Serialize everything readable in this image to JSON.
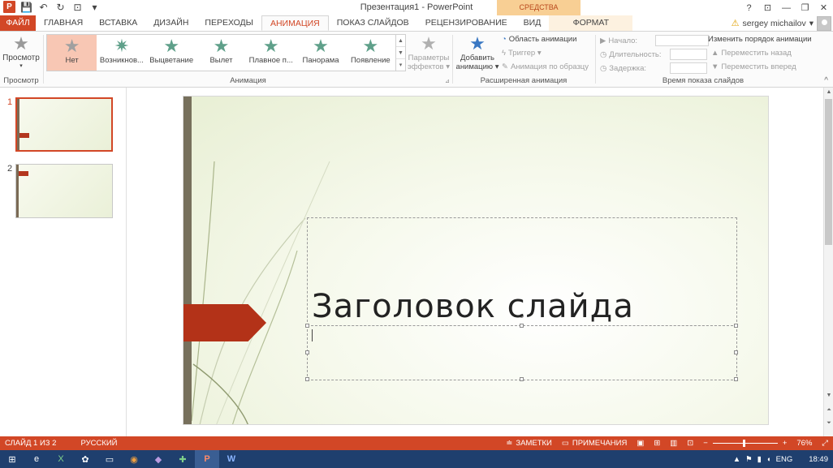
{
  "window": {
    "title": "Презентация1 - PowerPoint",
    "context_tab_header": "СРЕДСТВА РИСОВАНИЯ",
    "help": "?",
    "controls": [
      "⊡",
      "—",
      "❐",
      "✕"
    ]
  },
  "qat": {
    "app_icon": "P",
    "save": "💾",
    "undo": "↶",
    "redo": "↻",
    "present": "⊡",
    "more": "▾"
  },
  "tabs": [
    {
      "label": "ФАЙЛ"
    },
    {
      "label": "ГЛАВНАЯ"
    },
    {
      "label": "ВСТАВКА"
    },
    {
      "label": "ДИЗАЙН"
    },
    {
      "label": "ПЕРЕХОДЫ"
    },
    {
      "label": "АНИМАЦИЯ"
    },
    {
      "label": "ПОКАЗ СЛАЙДОВ"
    },
    {
      "label": "РЕЦЕНЗИРОВАНИЕ"
    },
    {
      "label": "ВИД"
    },
    {
      "label": "ФОРМАТ"
    }
  ],
  "user": {
    "name": "sergey michailov",
    "arrow": "▾",
    "warning": "⚠"
  },
  "ribbon": {
    "preview": {
      "label": "Просмотр",
      "group": "Просмотр"
    },
    "animation_group": "Анимация",
    "gallery": [
      "Нет",
      "Возникнов...",
      "Выцветание",
      "Вылет",
      "Плавное п...",
      "Панорама",
      "Появление"
    ],
    "effect_params": [
      "Параметры",
      "эффектов ▾"
    ],
    "add_animation": [
      "Добавить",
      "анимацию ▾"
    ],
    "anim_pane": "Область анимации",
    "trigger": "Триггер ▾",
    "anim_painter": "Анимация по образцу",
    "advanced_group": "Расширенная анимация",
    "start": "Начало:",
    "duration": "Длительность:",
    "delay": "Задержка:",
    "reorder_title": "Изменить порядок анимации",
    "move_back": "Переместить назад",
    "move_forward": "Переместить вперед",
    "timing_group": "Время показа слайдов",
    "collapse": "^"
  },
  "thumbnails": [
    {
      "num": "1"
    },
    {
      "num": "2"
    }
  ],
  "slide": {
    "title": "Заголовок слайда"
  },
  "statusbar": {
    "slide_info": "СЛАЙД 1 ИЗ 2",
    "language": "РУССКИЙ",
    "notes": "ЗАМЕТКИ",
    "comments": "ПРИМЕЧАНИЯ",
    "zoom_minus": "−",
    "zoom_plus": "+",
    "zoom": "76%"
  },
  "taskbar": {
    "icons": [
      "⊞",
      "e",
      "X",
      "✿",
      "▭",
      "◉",
      "◆",
      "✚",
      "P",
      "W"
    ],
    "lang": "ENG",
    "time": "18:49"
  },
  "colors": {
    "accent": "#d24726",
    "taskbar": "#1f3f6e",
    "context": "#f8cf94"
  }
}
